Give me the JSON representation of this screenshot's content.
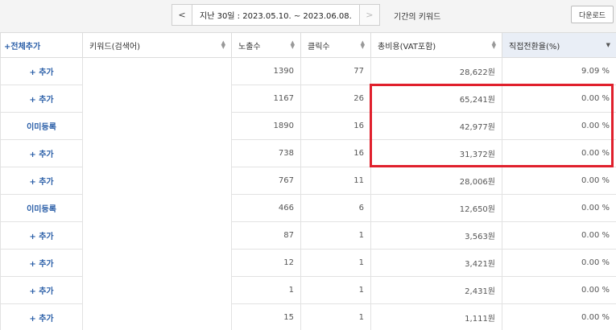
{
  "nav": {
    "prev_label": "<",
    "date_range": "지난 30일 : 2023.05.10. ~ 2023.06.08.",
    "next_label": ">",
    "period_title": "기간의 키워드",
    "download_label": "다운로드"
  },
  "table": {
    "headers": {
      "add_all": "+전체추가",
      "keyword": "키워드(검색어)",
      "impressions": "노출수",
      "clicks": "클릭수",
      "cost": "총비용(VAT포함)",
      "conversion": "직접전환율(%)"
    },
    "rows": [
      {
        "action": "+ 추가",
        "impressions": "1390",
        "clicks": "77",
        "cost": "28,622원",
        "conversion": "9.09 %"
      },
      {
        "action": "+ 추가",
        "impressions": "1167",
        "clicks": "26",
        "cost": "65,241원",
        "conversion": "0.00 %"
      },
      {
        "action": "이미등록",
        "impressions": "1890",
        "clicks": "16",
        "cost": "42,977원",
        "conversion": "0.00 %"
      },
      {
        "action": "+ 추가",
        "impressions": "738",
        "clicks": "16",
        "cost": "31,372원",
        "conversion": "0.00 %"
      },
      {
        "action": "+ 추가",
        "impressions": "767",
        "clicks": "11",
        "cost": "28,006원",
        "conversion": "0.00 %"
      },
      {
        "action": "이미등록",
        "impressions": "466",
        "clicks": "6",
        "cost": "12,650원",
        "conversion": "0.00 %"
      },
      {
        "action": "+ 추가",
        "impressions": "87",
        "clicks": "1",
        "cost": "3,563원",
        "conversion": "0.00 %"
      },
      {
        "action": "+ 추가",
        "impressions": "12",
        "clicks": "1",
        "cost": "3,421원",
        "conversion": "0.00 %"
      },
      {
        "action": "+ 추가",
        "impressions": "1",
        "clicks": "1",
        "cost": "2,431원",
        "conversion": "0.00 %"
      },
      {
        "action": "+ 추가",
        "impressions": "15",
        "clicks": "1",
        "cost": "1,111원",
        "conversion": "0.00 %"
      }
    ]
  },
  "colors": {
    "accent": "#2b5fa8",
    "highlight_border": "#e0202c"
  }
}
